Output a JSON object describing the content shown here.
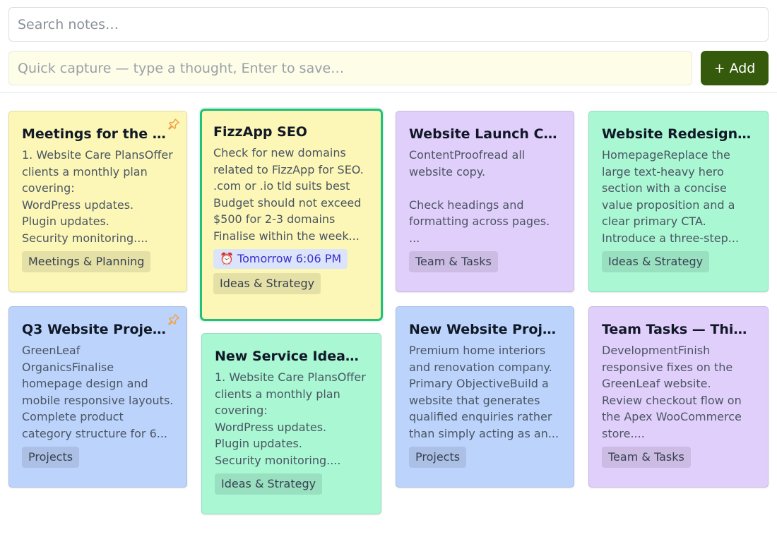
{
  "search": {
    "placeholder": "Search notes…"
  },
  "quick_capture": {
    "placeholder": "Quick capture — type a thought, Enter to save…"
  },
  "add_button": {
    "label": "+ Add"
  },
  "colors": {
    "yellow": "#fcf7b6",
    "blue": "#bcd4fb",
    "purple": "#e1cffb",
    "green": "#a9f7d3",
    "accent": "#365a0c",
    "selected_border": "#22c07a",
    "pin": "#f0a24a"
  },
  "notes": [
    {
      "title": "Meetings for the …",
      "body": "1. Website Care PlansOffer clients a monthly plan covering:\nWordPress updates.\nPlugin updates.\nSecurity monitoring....",
      "tag": "Meetings & Planning",
      "color": "yellow",
      "pinned": true
    },
    {
      "title": "FizzApp SEO",
      "body": "Check for new domains related to FizzApp for SEO.\n.com or .io tld suits best\nBudget should not exceed $500 for 2-3 domains\nFinalise within the week...",
      "reminder": "⏰ Tomorrow 6:06 PM",
      "tag": "Ideas & Strategy",
      "color": "yellow",
      "selected": true
    },
    {
      "title": "Website Launch C…",
      "body": "ContentProofread all website copy.\n\nCheck headings and formatting across pages.\n...",
      "tag": "Team & Tasks",
      "color": "purple"
    },
    {
      "title": "Website Redesign…",
      "body": "HomepageReplace the large text-heavy hero section with a concise value proposition and a clear primary CTA.\nIntroduce a three-step...",
      "tag": "Ideas & Strategy",
      "color": "green"
    },
    {
      "title": "Q3 Website Proje…",
      "body": "GreenLeaf OrganicsFinalise homepage design and mobile responsive layouts.\nComplete product category structure for 6...",
      "tag": "Projects",
      "color": "blue",
      "pinned": true
    },
    {
      "title": "New Service Idea…",
      "body": "1. Website Care PlansOffer clients a monthly plan covering:\nWordPress updates.\nPlugin updates.\nSecurity monitoring....",
      "tag": "Ideas & Strategy",
      "color": "green"
    },
    {
      "title": "New Website Proj…",
      "body": "Premium home interiors and renovation company.\nPrimary ObjectiveBuild a website that generates qualified enquiries rather than simply acting as an...",
      "tag": "Projects",
      "color": "blue"
    },
    {
      "title": "Team Tasks — Thi…",
      "body": "DevelopmentFinish responsive fixes on the GreenLeaf website.\nReview checkout flow on the Apex WooCommerce store....",
      "tag": "Team & Tasks",
      "color": "purple"
    }
  ]
}
